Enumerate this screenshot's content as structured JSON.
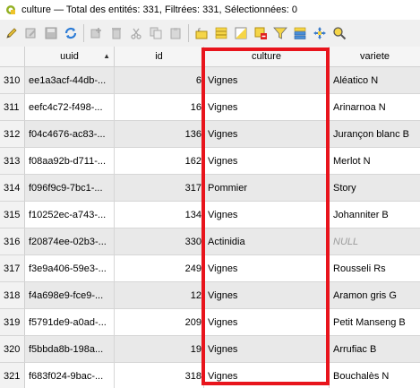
{
  "window": {
    "title": "culture — Total des entités: 331, Filtrées: 331, Sélectionnées: 0"
  },
  "toolbar": {
    "icons": [
      "pencil-icon",
      "multi-edit-icon",
      "save-icon",
      "reload-icon",
      "add-feature-icon",
      "delete-feature-icon",
      "cut-icon",
      "copy-icon",
      "paste-icon",
      "expression-select-icon",
      "select-all-icon",
      "invert-selection-icon",
      "deselect-all-icon",
      "filter-icon",
      "move-selection-top-icon",
      "pan-to-selection-icon",
      "zoom-to-selection-icon"
    ]
  },
  "table": {
    "columns": [
      "uuid",
      "id",
      "culture",
      "variete"
    ],
    "sorted_column": "uuid",
    "rows": [
      {
        "num": "310",
        "uuid": "ee1a3acf-44db-...",
        "id": "6",
        "culture": "Vignes",
        "variete": "Aléatico N"
      },
      {
        "num": "311",
        "uuid": "eefc4c72-f498-...",
        "id": "16",
        "culture": "Vignes",
        "variete": "Arinarnoa N"
      },
      {
        "num": "312",
        "uuid": "f04c4676-ac83-...",
        "id": "136",
        "culture": "Vignes",
        "variete": "Jurançon blanc B"
      },
      {
        "num": "313",
        "uuid": "f08aa92b-d711-...",
        "id": "162",
        "culture": "Vignes",
        "variete": "Merlot N"
      },
      {
        "num": "314",
        "uuid": "f096f9c9-7bc1-...",
        "id": "317",
        "culture": "Pommier",
        "variete": "Story"
      },
      {
        "num": "315",
        "uuid": "f10252ec-a743-...",
        "id": "134",
        "culture": "Vignes",
        "variete": "Johanniter B"
      },
      {
        "num": "316",
        "uuid": "f20874ee-02b3-...",
        "id": "330",
        "culture": "Actinidia",
        "variete": "NULL"
      },
      {
        "num": "317",
        "uuid": "f3e9a406-59e3-...",
        "id": "249",
        "culture": "Vignes",
        "variete": "Rousseli Rs"
      },
      {
        "num": "318",
        "uuid": "f4a698e9-fce9-...",
        "id": "12",
        "culture": "Vignes",
        "variete": "Aramon gris G"
      },
      {
        "num": "319",
        "uuid": "f5791de9-a0ad-...",
        "id": "209",
        "culture": "Vignes",
        "variete": "Petit Manseng B"
      },
      {
        "num": "320",
        "uuid": "f5bbda8b-198a...",
        "id": "19",
        "culture": "Vignes",
        "variete": "Arrufiac B"
      },
      {
        "num": "321",
        "uuid": "f683f024-9bac-...",
        "id": "318",
        "culture": "Vignes",
        "variete": "Bouchalès N"
      }
    ]
  },
  "colors": {
    "highlight": "#e8141c",
    "alt_row": "#e9e9e9"
  }
}
